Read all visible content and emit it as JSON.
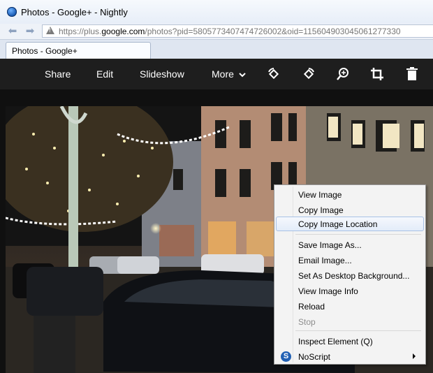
{
  "window": {
    "title": "Photos - Google+ - Nightly"
  },
  "navbar": {
    "back_icon": "arrow-left-icon",
    "forward_icon": "arrow-right-icon",
    "security_icon": "warning-triangle-icon",
    "url_prefix": "https://plus.",
    "url_domain": "google.com",
    "url_suffix": "/photos?pid=5805773407474726002&oid=115604903045061277330"
  },
  "tabs": [
    {
      "label": "Photos - Google+"
    }
  ],
  "gplus_toolbar": {
    "share_label": "Share",
    "edit_label": "Edit",
    "slideshow_label": "Slideshow",
    "more_label": "More",
    "icons": [
      "rotate-left-icon",
      "rotate-right-icon",
      "zoom-icon",
      "crop-icon",
      "trash-icon"
    ],
    "toolbar_color": "#1e1e1e"
  },
  "context_menu": {
    "items": [
      {
        "label": "View Image"
      },
      {
        "label": "Copy Image"
      },
      {
        "label": "Copy Image Location",
        "highlighted": true
      },
      {
        "label": "Save Image As..."
      },
      {
        "label": "Email Image..."
      },
      {
        "label": "Set As Desktop Background..."
      },
      {
        "label": "View Image Info"
      },
      {
        "label": "Reload"
      },
      {
        "label": "Stop",
        "disabled": true
      },
      {
        "label": "Inspect Element (Q)"
      },
      {
        "label": "NoScript",
        "icon": "noscript-s-icon",
        "submenu": true
      }
    ],
    "highlight_color": "#a8c1e5"
  }
}
